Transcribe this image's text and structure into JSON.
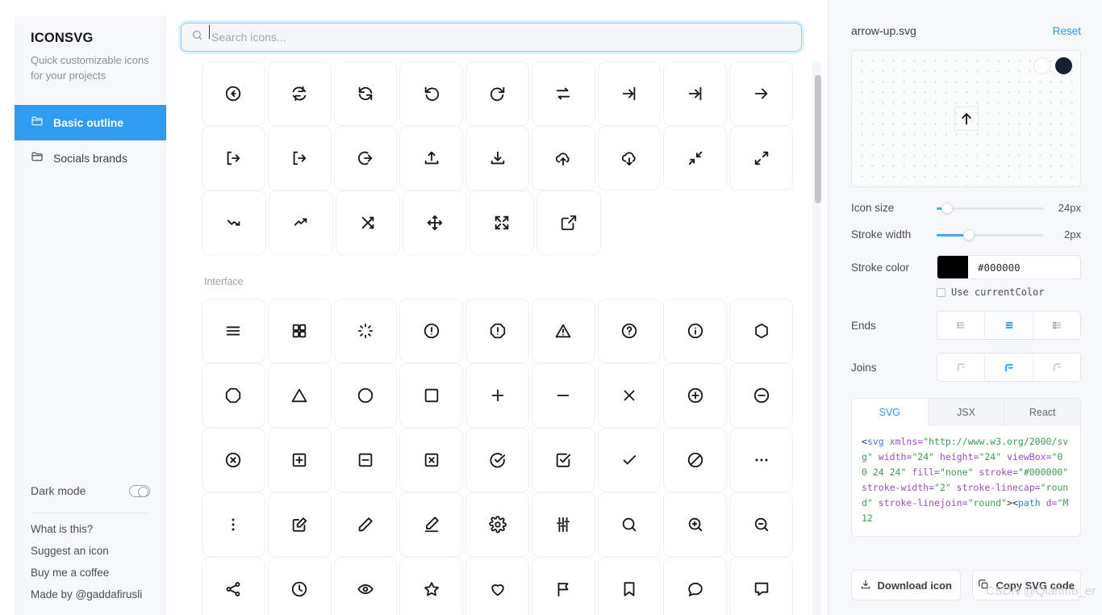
{
  "sidebar": {
    "brand_title": "ICONSVG",
    "brand_subtitle": "Quick customizable icons for your projects",
    "nav": [
      {
        "label": "Basic outline",
        "icon": "folder-icon",
        "active": true
      },
      {
        "label": "Socials brands",
        "icon": "folder-icon",
        "active": false
      }
    ],
    "dark_mode_label": "Dark mode",
    "dark_mode_on": false,
    "links": [
      "What is this?",
      "Suggest an icon",
      "Buy me a coffee",
      "Made by @gaddafirusli"
    ]
  },
  "search": {
    "placeholder": "Search icons...",
    "value": "",
    "icon": "search-icon",
    "focused": true
  },
  "grid": {
    "sections": [
      {
        "label": "",
        "rows": [
          [
            "arrow-left-circle-icon",
            "refresh-icon",
            "refresh-cw-icon",
            "rotate-ccw-icon",
            "rotate-cw-icon",
            "transfer-icon",
            "log-in-icon",
            "log-in-alt-icon",
            "arrow-right-icon"
          ],
          [
            "log-out-icon",
            "log-out-alt-icon",
            "arrow-right-circle-icon",
            "upload-icon",
            "download-icon",
            "upload-cloud-icon",
            "download-cloud-icon",
            "minimize-icon",
            "maximize-icon"
          ],
          [
            "trending-down-icon",
            "trending-up-icon",
            "shuffle-icon",
            "move-icon",
            "expand-icon",
            "external-link-icon"
          ]
        ]
      },
      {
        "label": "Interface",
        "rows": [
          [
            "menu-icon",
            "grid-icon",
            "loader-icon",
            "alert-circle-icon",
            "alert-octagon-icon",
            "alert-triangle-icon",
            "help-circle-icon",
            "info-icon",
            "hexagon-icon"
          ],
          [
            "octagon-icon",
            "triangle-icon",
            "circle-icon",
            "square-icon",
            "plus-icon",
            "minus-icon",
            "x-icon",
            "plus-circle-icon",
            "minus-circle-icon"
          ],
          [
            "x-circle-icon",
            "plus-square-icon",
            "minus-square-icon",
            "x-square-icon",
            "check-circle-icon",
            "check-square-icon",
            "check-icon",
            "slash-icon",
            "more-horizontal-icon"
          ],
          [
            "more-vertical-icon",
            "edit-square-icon",
            "pencil-icon",
            "edit-underline-icon",
            "settings-icon",
            "sliders-icon",
            "search-icon",
            "zoom-in-icon",
            "zoom-out-icon"
          ],
          [
            "share-icon",
            "clock-icon",
            "eye-icon",
            "star-icon",
            "heart-icon",
            "flag-icon",
            "bookmark-icon",
            "message-circle-icon",
            "message-square-icon"
          ]
        ]
      }
    ]
  },
  "panel": {
    "file_name": "arrow-up.svg",
    "reset_label": "Reset",
    "preview": {
      "icon": "arrow-up-icon",
      "background_swatches": [
        {
          "name": "light-background-swatch",
          "color": "#ffffff",
          "selected": false
        },
        {
          "name": "dark-background-swatch",
          "color": "#16202e",
          "selected": true
        }
      ]
    },
    "icon_size": {
      "label": "Icon size",
      "value": "24px",
      "percent": 10
    },
    "stroke_width": {
      "label": "Stroke width",
      "value": "2px",
      "percent": 30
    },
    "stroke_color": {
      "label": "Stroke color",
      "value": "#000000",
      "swatch": "#000000"
    },
    "use_current_color": {
      "label": "Use currentColor",
      "checked": false
    },
    "ends": {
      "label": "Ends",
      "options": [
        "butt-cap-icon",
        "round-cap-icon",
        "square-cap-icon"
      ],
      "selected_index": 1
    },
    "joins": {
      "label": "Joins",
      "options": [
        "miter-join-icon",
        "round-join-icon",
        "bevel-join-icon"
      ],
      "selected_index": 1
    },
    "code": {
      "tabs": [
        "SVG",
        "JSX",
        "React"
      ],
      "active_tab": "SVG",
      "snippet_tokens": [
        {
          "t": "punc",
          "v": "<"
        },
        {
          "t": "tag",
          "v": "svg"
        },
        {
          "t": "plain",
          "v": " "
        },
        {
          "t": "attr",
          "v": "xmlns="
        },
        {
          "t": "str",
          "v": "\"http://www.w3.org/2000/svg\""
        },
        {
          "t": "plain",
          "v": " "
        },
        {
          "t": "attr",
          "v": "width="
        },
        {
          "t": "str",
          "v": "\"24\""
        },
        {
          "t": "plain",
          "v": " "
        },
        {
          "t": "attr",
          "v": "height="
        },
        {
          "t": "str",
          "v": "\"24\""
        },
        {
          "t": "plain",
          "v": " "
        },
        {
          "t": "attr",
          "v": "viewBox="
        },
        {
          "t": "str",
          "v": "\"0 0 24 24\""
        },
        {
          "t": "plain",
          "v": " "
        },
        {
          "t": "attr",
          "v": "fill="
        },
        {
          "t": "str",
          "v": "\"none\""
        },
        {
          "t": "plain",
          "v": " "
        },
        {
          "t": "attr",
          "v": "stroke="
        },
        {
          "t": "str",
          "v": "\"#000000\""
        },
        {
          "t": "plain",
          "v": " "
        },
        {
          "t": "attr",
          "v": "stroke-width="
        },
        {
          "t": "str",
          "v": "\"2\""
        },
        {
          "t": "plain",
          "v": " "
        },
        {
          "t": "attr",
          "v": "stroke-linecap="
        },
        {
          "t": "str",
          "v": "\"round\""
        },
        {
          "t": "plain",
          "v": " "
        },
        {
          "t": "attr",
          "v": "stroke-linejoin="
        },
        {
          "t": "str",
          "v": "\"round\""
        },
        {
          "t": "punc",
          "v": ">"
        },
        {
          "t": "punc",
          "v": "<"
        },
        {
          "t": "tag",
          "v": "path"
        },
        {
          "t": "plain",
          "v": " "
        },
        {
          "t": "attr",
          "v": "d="
        },
        {
          "t": "str",
          "v": "\"M12"
        }
      ]
    },
    "download_label": "Download icon",
    "copy_label": "Copy SVG code",
    "download_icon": "download-icon",
    "copy_icon": "copy-icon"
  },
  "watermark": "CSDN @Qianmo_er",
  "colors": {
    "accent": "#2f9bf3",
    "slider": "#4aa7f5",
    "text": "#3b4045",
    "muted": "#9aa0a6"
  }
}
